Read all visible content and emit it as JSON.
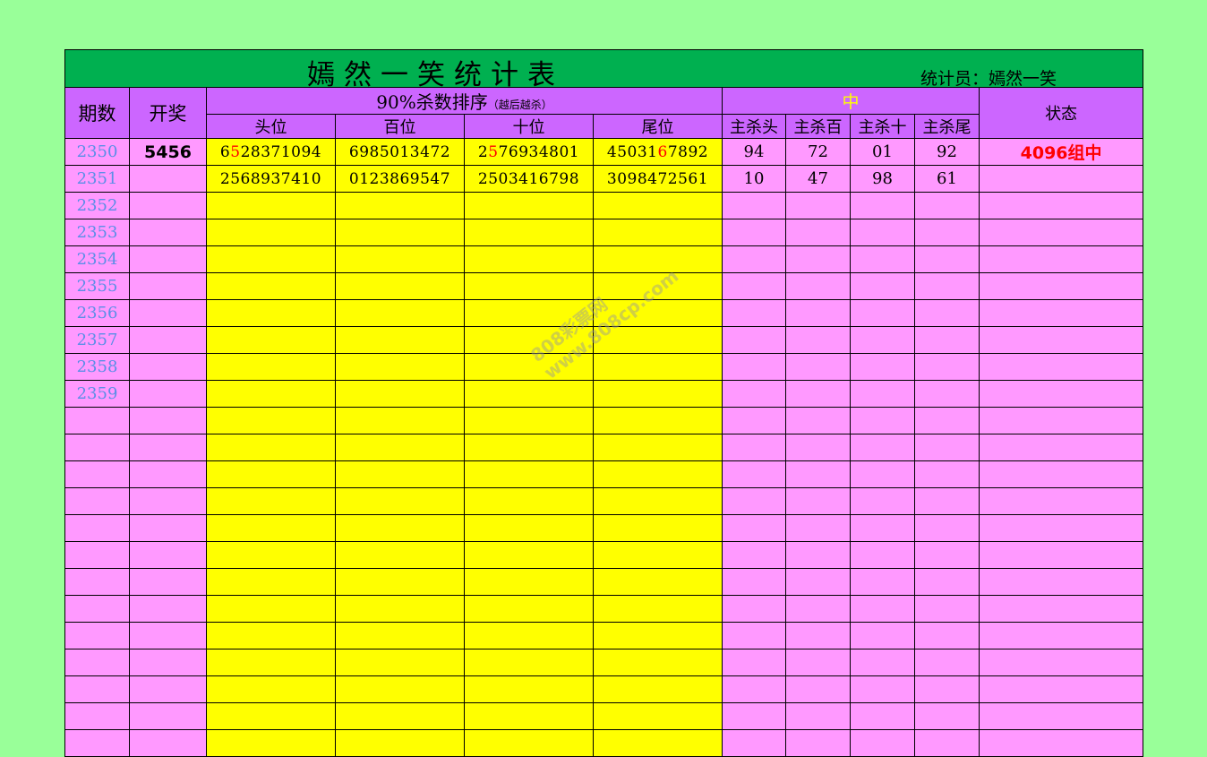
{
  "title": "嫣然一笑统计表",
  "statistician": "统计员：嫣然一笑",
  "headers": {
    "period": "期数",
    "draw": "开奖",
    "ranking_main": "90%杀数排序",
    "ranking_note": "（越后越杀）",
    "positions": [
      "头位",
      "百位",
      "十位",
      "尾位"
    ],
    "hit_header": "中",
    "kill_cols": [
      "主杀头",
      "主杀百",
      "主杀十",
      "主杀尾"
    ],
    "status": "状态"
  },
  "rows": [
    {
      "period": "2350",
      "draw": "5456",
      "seqs": [
        {
          "pre": "6",
          "hit": "5",
          "post": "28371094"
        },
        {
          "pre": "69850134",
          "hit": "",
          "post": "72"
        },
        {
          "pre": "2",
          "hit": "5",
          "post": "76934801"
        },
        {
          "pre": "45031",
          "hit": "6",
          "post": "7892"
        }
      ],
      "kills": [
        "94",
        "72",
        "01",
        "92"
      ],
      "status": "4096组中"
    },
    {
      "period": "2351",
      "draw": "",
      "seqs": [
        {
          "pre": "2568937410",
          "hit": "",
          "post": ""
        },
        {
          "pre": "0123869547",
          "hit": "",
          "post": ""
        },
        {
          "pre": "2503416798",
          "hit": "",
          "post": ""
        },
        {
          "pre": "3098472561",
          "hit": "",
          "post": ""
        }
      ],
      "kills": [
        "10",
        "47",
        "98",
        "61"
      ],
      "status": ""
    },
    {
      "period": "2352"
    },
    {
      "period": "2353"
    },
    {
      "period": "2354"
    },
    {
      "period": "2355"
    },
    {
      "period": "2356"
    },
    {
      "period": "2357"
    },
    {
      "period": "2358"
    },
    {
      "period": "2359"
    },
    {
      "period": ""
    },
    {
      "period": ""
    },
    {
      "period": ""
    },
    {
      "period": ""
    },
    {
      "period": ""
    },
    {
      "period": ""
    },
    {
      "period": ""
    },
    {
      "period": ""
    },
    {
      "period": ""
    },
    {
      "period": ""
    },
    {
      "period": ""
    },
    {
      "period": ""
    },
    {
      "period": ""
    }
  ],
  "watermark": [
    "808彩票网",
    "www.808cp.com"
  ],
  "colors": {
    "background": "#99ff99",
    "title_bar": "#00b050",
    "header": "#cc66ff",
    "row": "#ff99ff",
    "highlight": "#ffff00",
    "hit": "#ff0000",
    "period_text": "#5b8ee6"
  }
}
